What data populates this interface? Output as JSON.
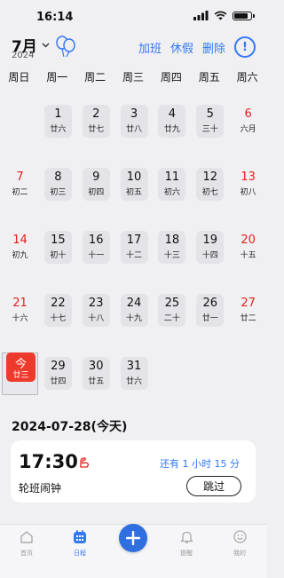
{
  "status": {
    "time": "16:14"
  },
  "header": {
    "month": "7月",
    "year": "2024",
    "actions": [
      "加班",
      "休假",
      "删除"
    ],
    "alert": "!"
  },
  "weekdays": [
    "周日",
    "周一",
    "周二",
    "周三",
    "周四",
    "周五",
    "周六"
  ],
  "calendar": {
    "weeks": [
      [
        null,
        {
          "n": "1",
          "l": "廿六"
        },
        {
          "n": "2",
          "l": "廿七"
        },
        {
          "n": "3",
          "l": "廿八"
        },
        {
          "n": "4",
          "l": "廿九"
        },
        {
          "n": "5",
          "l": "三十"
        },
        {
          "n": "6",
          "l": "六月"
        }
      ],
      [
        {
          "n": "7",
          "l": "初二"
        },
        {
          "n": "8",
          "l": "初三"
        },
        {
          "n": "9",
          "l": "初四"
        },
        {
          "n": "10",
          "l": "初五"
        },
        {
          "n": "11",
          "l": "初六"
        },
        {
          "n": "12",
          "l": "初七"
        },
        {
          "n": "13",
          "l": "初八"
        }
      ],
      [
        {
          "n": "14",
          "l": "初九"
        },
        {
          "n": "15",
          "l": "初十"
        },
        {
          "n": "16",
          "l": "十一"
        },
        {
          "n": "17",
          "l": "十二"
        },
        {
          "n": "18",
          "l": "十三"
        },
        {
          "n": "19",
          "l": "十四"
        },
        {
          "n": "20",
          "l": "十五"
        }
      ],
      [
        {
          "n": "21",
          "l": "十六"
        },
        {
          "n": "22",
          "l": "十七"
        },
        {
          "n": "23",
          "l": "十八"
        },
        {
          "n": "24",
          "l": "十九"
        },
        {
          "n": "25",
          "l": "二十"
        },
        {
          "n": "26",
          "l": "廿一"
        },
        {
          "n": "27",
          "l": "廿二"
        }
      ],
      [
        {
          "n": "今",
          "l": "廿三",
          "today": true
        },
        {
          "n": "29",
          "l": "廿四"
        },
        {
          "n": "30",
          "l": "廿五"
        },
        {
          "n": "31",
          "l": "廿六"
        },
        null,
        null,
        null
      ]
    ]
  },
  "selected_date": "2024-07-28(今天)",
  "alarm": {
    "time": "17:30",
    "name": "轮班闹钟",
    "remaining": "还有 1 小时 15 分",
    "skip_label": "跳过"
  },
  "tabbar": {
    "items": [
      "首页",
      "日程",
      "提醒",
      "我的"
    ],
    "active": "日程"
  },
  "colors": {
    "accent": "#3478f6",
    "weekend": "#e5211c",
    "today": "#ee3a2c",
    "fab": "#2f6fe0"
  }
}
